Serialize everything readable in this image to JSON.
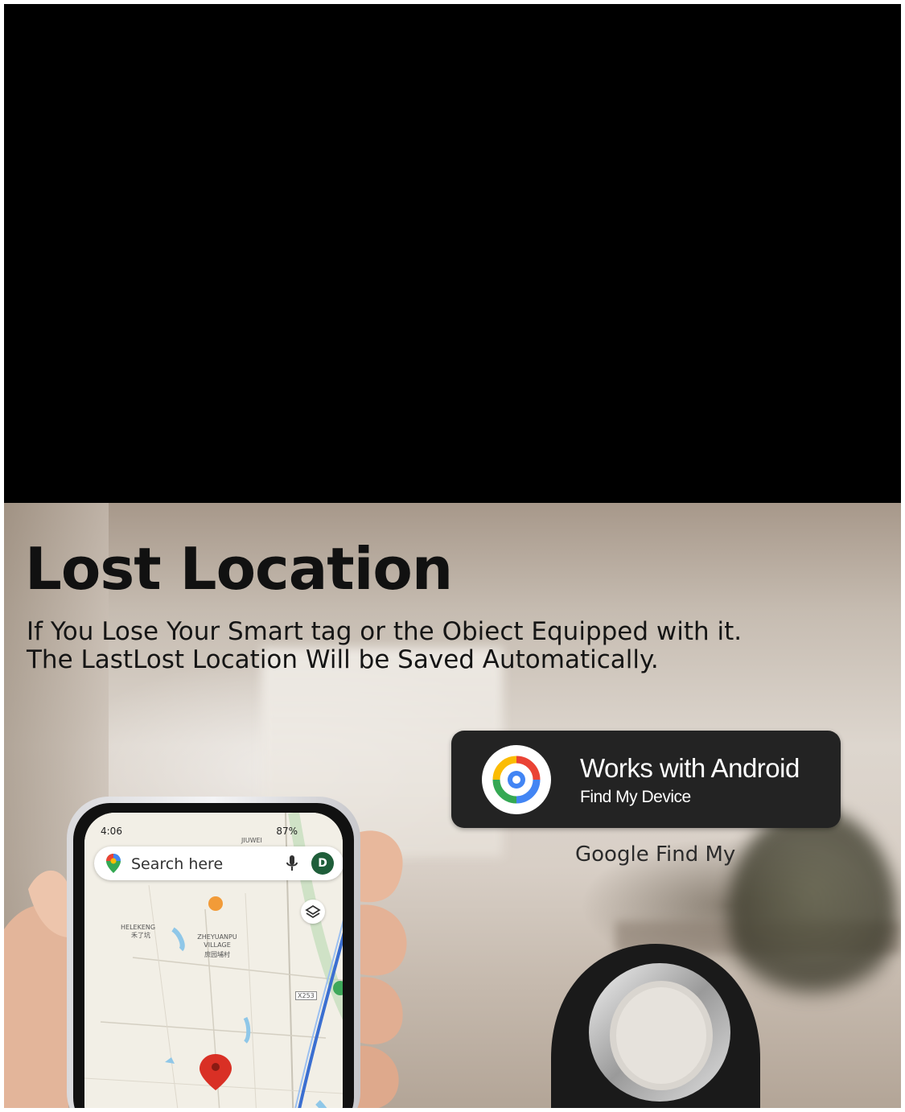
{
  "hero": {
    "title": "Lost Location",
    "description": "If You Lose Your Smart tag or the Obiect Equipped with it.   The LastLost Location Will be Saved Automatically."
  },
  "badge": {
    "title": "Works with Android",
    "subtitle": "Find My Device",
    "caption": "Google Find My"
  },
  "phone": {
    "time": "4:06",
    "battery": "87%",
    "search_placeholder": "Search here",
    "avatar_initial": "D",
    "map_labels": {
      "top": "JIUWEI",
      "village": "ZHEYUANPU VILLAGE",
      "village_cn": "庶园埔村",
      "left": "HELEKENG",
      "left_cn": "禾了坑",
      "road": "X253"
    }
  },
  "colors": {
    "badge_bg": "#232323",
    "title_text": "#111111",
    "pin_red": "#d93025"
  }
}
